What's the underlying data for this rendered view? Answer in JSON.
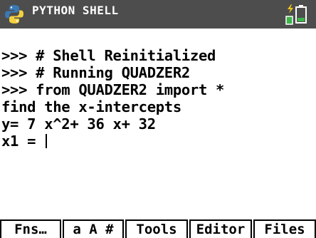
{
  "title_bar": {
    "app_title": "PYTHON SHELL",
    "background_color": "#4d4d4d",
    "logo_icon": "python-logo-icon",
    "status_icon": "battery-icon",
    "battery_color": "#3cb54a"
  },
  "shell": {
    "lines": [
      ">>> # Shell Reinitialized",
      ">>> # Running QUADZER2",
      ">>> from QUADZER2 import *",
      "find the x-intercepts",
      "y= 7 x^2+ 36 x+ 32",
      "x1 = "
    ],
    "cursor_line_index": 5
  },
  "softkeys": [
    {
      "label": "Fns…"
    },
    {
      "label": "a A #"
    },
    {
      "label": "Tools"
    },
    {
      "label": "Editor"
    },
    {
      "label": "Files"
    }
  ]
}
